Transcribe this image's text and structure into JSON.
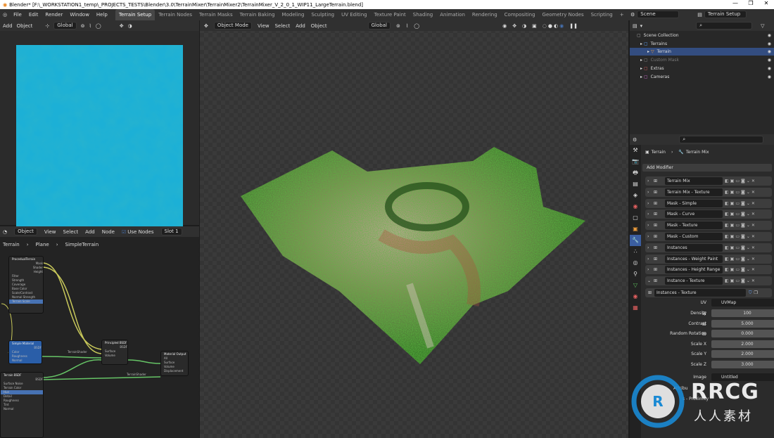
{
  "titlebar": {
    "title": "Blender* [F:\\_WORKSTATION1_temp\\_PROJECTS_TESTS\\Blender\\3.0\\TerrainMixer\\TerrainMixer2\\TerrainMixer_V_2_0_1_WIP11_LargeTerrain.blend]",
    "minimize": "—",
    "maximize": "❐",
    "close": "✕"
  },
  "menu": [
    "File",
    "Edit",
    "Render",
    "Window",
    "Help"
  ],
  "workspaces": [
    "Terrain Setup",
    "Terrain Nodes",
    "Terrain Masks",
    "Terrain Baking",
    "Modeling",
    "Sculpting",
    "UV Editing",
    "Texture Paint",
    "Shading",
    "Animation",
    "Rendering",
    "Compositing",
    "Geometry Nodes",
    "Scripting"
  ],
  "active_workspace": "Terrain Setup",
  "add_ws": "+",
  "scene": "Scene",
  "view_layer": "Terrain Setup",
  "imgeditor": {
    "items": [
      "Add",
      "Object",
      "Global"
    ]
  },
  "nodeeditor": {
    "header": [
      "Object",
      "View",
      "Select",
      "Add",
      "Node"
    ],
    "use_nodes": "Use Nodes",
    "slot": "Slot 1",
    "breadcrumb": [
      "Terrain",
      "Plane",
      "SimpleTerrain"
    ],
    "nodes": [
      {
        "title": "ProcedualTerrain",
        "color": "#2f5f38",
        "lines": [
          "Mask",
          "Shader",
          "Height",
          "Filter",
          "Strength",
          "Coverage",
          "Base Color",
          "Scale/Contrast",
          "Normal Strength",
          "Terrain Scale"
        ]
      },
      {
        "title": "Principled BSDF",
        "color": "#3a7a4a",
        "lines": [
          "BSDF",
          "Surface",
          "Volume"
        ]
      },
      {
        "title": "Material Output",
        "color": "#6b2f2f",
        "lines": [
          "All",
          "Surface",
          "Volume",
          "Displacement"
        ]
      },
      {
        "title": "Simple Material",
        "color": "#2a5ea8",
        "lines": [
          "BSDF",
          "Color",
          "Roughness",
          "Normal"
        ]
      },
      {
        "title": "Terrain BSDF",
        "color": "#2f5f38",
        "lines": [
          "BSDF",
          "Surface Noise",
          "Terrain Color",
          "Hue",
          "Detail",
          "Roughness",
          "Tint",
          "Normal"
        ]
      }
    ],
    "link_labels": [
      "TerrainShader",
      "TerrainShader"
    ]
  },
  "viewport": {
    "header": [
      "Object Mode",
      "View",
      "Select",
      "Add",
      "Object",
      "Global"
    ]
  },
  "outliner": {
    "search_placeholder": "",
    "items": [
      {
        "label": "Scene Collection",
        "indent": 0,
        "icon": "scene-collection-icon",
        "color": "#aaaaaa"
      },
      {
        "label": "Terrains",
        "indent": 1,
        "icon": "collection-icon",
        "color": "#5ea7ff"
      },
      {
        "label": "Terrain",
        "indent": 2,
        "icon": "mesh-icon",
        "color": "#e89a3c",
        "selected": true
      },
      {
        "label": "Custom Mask",
        "indent": 1,
        "icon": "collection-icon",
        "color": "#888888",
        "dim": true
      },
      {
        "label": "Extras",
        "indent": 1,
        "icon": "collection-icon",
        "color": "#e05f5f"
      },
      {
        "label": "Cameras",
        "indent": 1,
        "icon": "collection-icon",
        "color": "#d06ad0"
      }
    ]
  },
  "properties": {
    "breadcrumb": [
      "Terrain",
      "Terrain Mix"
    ],
    "add_modifier": "Add Modifier",
    "modifiers": [
      "Terrain Mix",
      "Terrain Mix - Texture",
      "Mask - Simple",
      "Mask - Curve",
      "Mask - Texture",
      "Mask - Custom",
      "Instances",
      "Instances - Weight Paint",
      "Instances - Height Range",
      "Instance - Texture"
    ],
    "node_group": "Instances - Texture",
    "uv_label": "UV",
    "uv_value": "UVMap",
    "fields": [
      {
        "label": "Density",
        "value": "100"
      },
      {
        "label": "Contrast",
        "value": "5.000"
      },
      {
        "label": "Random Rotation",
        "value": "0.000"
      },
      {
        "label": "Scale X",
        "value": "2.000"
      },
      {
        "label": "Scale Y",
        "value": "2.000"
      },
      {
        "label": "Scale Z",
        "value": "3.000"
      }
    ],
    "image_label": "Image",
    "image_value": "Untitled",
    "partial_label_1": "Attribu",
    "partial_label_2": "s - Proximity"
  },
  "watermark": {
    "logo": "RRCG",
    "sub": "人人素材"
  },
  "colors": {
    "accent": "#4772b3",
    "selected_row": "#334d80",
    "texture": "#1aa7cc"
  }
}
